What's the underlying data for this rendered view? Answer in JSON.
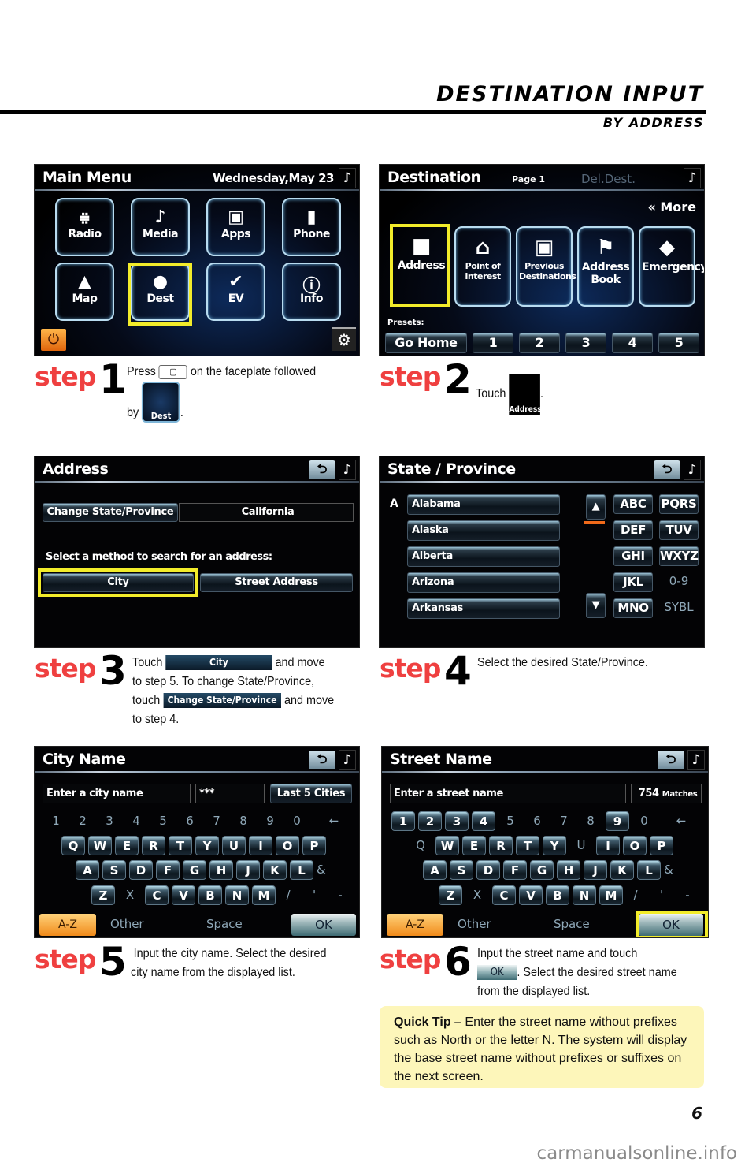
{
  "header": {
    "title": "DESTINATION INPUT",
    "subtitle": "BY ADDRESS"
  },
  "colors": {
    "step_red": "#ef4040",
    "highlight_yellow": "#f2ec2a",
    "tip_bg": "#fdf6ba",
    "az_orange": "#f08a1a"
  },
  "screens": {
    "main_menu": {
      "title": "Main Menu",
      "date": "Wednesday,May 23",
      "note_icon": "♪",
      "tiles": [
        {
          "label": "Radio",
          "icon": "radio-tower-icon",
          "glyph": "⩷"
        },
        {
          "label": "Media",
          "icon": "music-note-icon",
          "glyph": "♪"
        },
        {
          "label": "Apps",
          "icon": "apps-icon",
          "glyph": "▣"
        },
        {
          "label": "Phone",
          "icon": "phone-icon",
          "glyph": "▮"
        },
        {
          "label": "Map",
          "icon": "compass-icon",
          "glyph": "▲"
        },
        {
          "label": "Dest",
          "icon": "pin-icon",
          "glyph": "●"
        },
        {
          "label": "EV",
          "icon": "ev-plug-icon",
          "glyph": "✔"
        },
        {
          "label": "Info",
          "icon": "info-icon",
          "glyph": "ⓘ"
        }
      ],
      "highlighted": "Dest"
    },
    "destination": {
      "title": "Destination",
      "page": "Page 1",
      "del_dest": "Del.Dest.",
      "more": "« More",
      "tiles": [
        {
          "label": "Address",
          "glyph": "■"
        },
        {
          "label": "Point of Interest",
          "glyph": "⌂"
        },
        {
          "label": "Previous Destinations",
          "glyph": "▣"
        },
        {
          "label": "Address Book",
          "glyph": "⚑"
        },
        {
          "label": "Emergency",
          "glyph": "◆"
        }
      ],
      "presets_label": "Presets:",
      "presets": [
        "Go Home",
        "1",
        "2",
        "3",
        "4",
        "5"
      ],
      "highlighted": "Address"
    },
    "address": {
      "title": "Address",
      "change_state": "Change State/Province",
      "state_value": "California",
      "prompt": "Select a method to search for an address:",
      "city": "City",
      "street_address": "Street Address",
      "highlighted": "City"
    },
    "state_province": {
      "title": "State / Province",
      "index_letter": "A",
      "states": [
        "Alabama",
        "Alaska",
        "Alberta",
        "Arizona",
        "Arkansas"
      ],
      "groups_col1": [
        "ABC",
        "DEF",
        "GHI",
        "JKL",
        "MNO"
      ],
      "groups_col2": [
        "PQRS",
        "TUV",
        "WXYZ",
        "0-9",
        "SYBL"
      ]
    },
    "city_name": {
      "title": "City Name",
      "placeholder": "Enter a city name",
      "mask": "***",
      "last5": "Last 5 Cities",
      "numbers": [
        "1",
        "2",
        "3",
        "4",
        "5",
        "6",
        "7",
        "8",
        "9",
        "0"
      ],
      "row1": [
        "Q",
        "W",
        "E",
        "R",
        "T",
        "Y",
        "U",
        "I",
        "O",
        "P"
      ],
      "row2": [
        "A",
        "S",
        "D",
        "F",
        "G",
        "H",
        "J",
        "K",
        "L"
      ],
      "row2_extra": "&",
      "row3": [
        "Z",
        "X",
        "C",
        "V",
        "B",
        "N",
        "M"
      ],
      "row3_extra": [
        "/",
        "'",
        "-"
      ],
      "az": "A-Z",
      "other": "Other",
      "space": "Space",
      "ok": "OK"
    },
    "street_name": {
      "title": "Street Name",
      "placeholder": "Enter a street name",
      "matches_count": "754",
      "matches_label": "Matches",
      "numbers": [
        "1",
        "2",
        "3",
        "4",
        "5",
        "6",
        "7",
        "8",
        "9",
        "0"
      ],
      "row1": [
        "Q",
        "W",
        "E",
        "R",
        "T",
        "Y",
        "U",
        "I",
        "O",
        "P"
      ],
      "row2": [
        "A",
        "S",
        "D",
        "F",
        "G",
        "H",
        "J",
        "K",
        "L"
      ],
      "row2_extra": "&",
      "row3": [
        "Z",
        "X",
        "C",
        "V",
        "B",
        "N",
        "M"
      ],
      "row3_extra": [
        "/",
        "'",
        "-"
      ],
      "az": "A-Z",
      "other": "Other",
      "space": "Space",
      "ok": "OK",
      "highlighted": "OK"
    }
  },
  "steps": [
    {
      "word": "step",
      "num": "1",
      "text_a": "Press",
      "text_b": "on the faceplate followed",
      "text_c": "by",
      "chip": "Dest",
      "end": "."
    },
    {
      "word": "step",
      "num": "2",
      "text_a": "Touch",
      "chip": "Address",
      "end": "."
    },
    {
      "word": "step",
      "num": "3",
      "text_a": "Touch",
      "chip": "City",
      "text_b": "and move",
      "text_c": "to step 5. To change State/Province,",
      "text_d": "touch",
      "chip2": "Change State/Province",
      "text_e": "and move",
      "text_f": "to step 4."
    },
    {
      "word": "step",
      "num": "4",
      "text_a": "Select the desired State/Province."
    },
    {
      "word": "step",
      "num": "5",
      "text_a": "Input the city name. Select the desired",
      "text_b": "city name from the displayed list."
    },
    {
      "word": "step",
      "num": "6",
      "text_a": "Input the street name and touch",
      "chip": "OK",
      "text_b": ". Select the desired street name",
      "text_c": "from the displayed list."
    }
  ],
  "quick_tip": {
    "label": "Quick Tip",
    "text": "– Enter the street name without prefixes such as North or the letter N.  The system will display the base street name without prefixes or suffixes on the next screen."
  },
  "page_number": "6",
  "watermark": "carmanualsonline.info"
}
